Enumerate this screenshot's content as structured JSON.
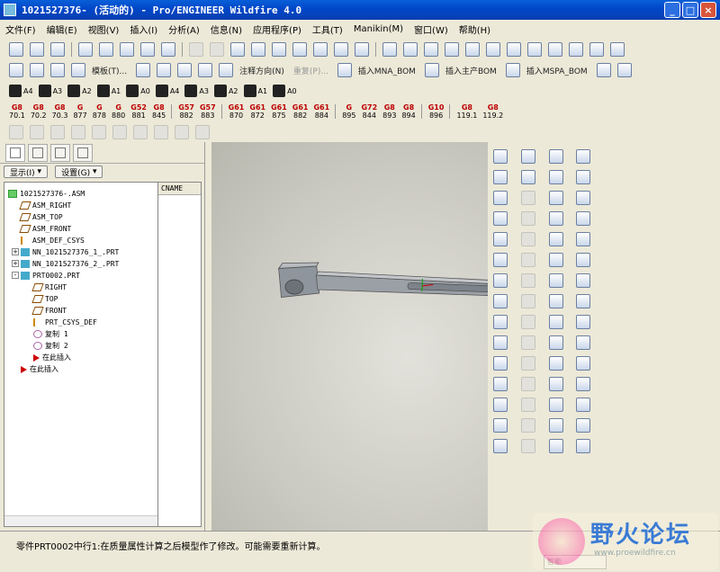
{
  "window": {
    "title": "1021527376- (活动的) - Pro/ENGINEER Wildfire 4.0"
  },
  "menu": [
    "文件(F)",
    "编辑(E)",
    "视图(V)",
    "插入(I)",
    "分析(A)",
    "信息(N)",
    "应用程序(P)",
    "工具(T)",
    "Manikin(M)",
    "窗口(W)",
    "帮助(H)"
  ],
  "toolbar2": {
    "label_annotate": "模板(T)...",
    "label_note_dir": "注释方向(N)",
    "label_repeat": "重复(P)...",
    "btn_insert_mna_bom": "插入MNA_BOM",
    "btn_insert_main_bom": "插入主产BOM",
    "btn_insert_mspa_bom": "插入MSPA_BOM"
  },
  "print_buttons": [
    "A4",
    "A3",
    "A2",
    "A1",
    "A0",
    "A4",
    "A3",
    "A2",
    "A1",
    "A0"
  ],
  "gbuttons": [
    {
      "g": "G8",
      "n": "70.1"
    },
    {
      "g": "G8",
      "n": "70.2"
    },
    {
      "g": "G8",
      "n": "70.3"
    },
    {
      "g": "G",
      "n": "877"
    },
    {
      "g": "G",
      "n": "878"
    },
    {
      "g": "G",
      "n": "880"
    },
    {
      "g": "G52",
      "n": "881"
    },
    {
      "g": "G8",
      "n": "845"
    },
    {
      "g": "G57",
      "n": "882"
    },
    {
      "g": "G57",
      "n": "883"
    },
    {
      "g": "G61",
      "n": "870"
    },
    {
      "g": "G61",
      "n": "872"
    },
    {
      "g": "G61",
      "n": "875"
    },
    {
      "g": "G61",
      "n": "882"
    },
    {
      "g": "G61",
      "n": "884"
    },
    {
      "g": "G",
      "n": "895"
    },
    {
      "g": "G72",
      "n": "844"
    },
    {
      "g": "G8",
      "n": "893"
    },
    {
      "g": "G8",
      "n": "894"
    },
    {
      "g": "G10",
      "n": "896"
    },
    {
      "g": "G8",
      "n": "119.1"
    },
    {
      "g": "G8",
      "n": "119.2"
    }
  ],
  "panel": {
    "show_label": "显示(I)",
    "settings_label": "设置(G)",
    "cname_header": "CNAME"
  },
  "tree": [
    {
      "label": "1021527376-.ASM",
      "icon": "asm",
      "level": 0
    },
    {
      "label": "ASM_RIGHT",
      "icon": "plane",
      "level": 1
    },
    {
      "label": "ASM_TOP",
      "icon": "plane",
      "level": 1
    },
    {
      "label": "ASM_FRONT",
      "icon": "plane",
      "level": 1
    },
    {
      "label": "ASM_DEF_CSYS",
      "icon": "csys",
      "level": 1
    },
    {
      "label": "NN_1021527376_1_.PRT",
      "icon": "part",
      "level": 1,
      "expand": "+"
    },
    {
      "label": "NN_1021527376_2_.PRT",
      "icon": "part",
      "level": 1,
      "expand": "+"
    },
    {
      "label": "PRT0002.PRT",
      "icon": "part",
      "level": 1,
      "expand": "-"
    },
    {
      "label": "RIGHT",
      "icon": "plane",
      "level": 2
    },
    {
      "label": "TOP",
      "icon": "plane",
      "level": 2
    },
    {
      "label": "FRONT",
      "icon": "plane",
      "level": 2
    },
    {
      "label": "PRT_CSYS_DEF",
      "icon": "csys",
      "level": 2
    },
    {
      "label": "复制 1",
      "icon": "copy",
      "level": 2
    },
    {
      "label": "复制 2",
      "icon": "copy",
      "level": 2
    },
    {
      "label": "在此插入",
      "icon": "arrow",
      "level": 2
    },
    {
      "label": "在此插入",
      "icon": "arrow",
      "level": 1
    }
  ],
  "status": {
    "message": "零件PRT0002中行1:在质量属性计算之后模型作了修改。可能需要重新计算。",
    "filter": "智能"
  },
  "watermark": {
    "text": "野火论坛",
    "url": "www.proewildfire.cn"
  }
}
